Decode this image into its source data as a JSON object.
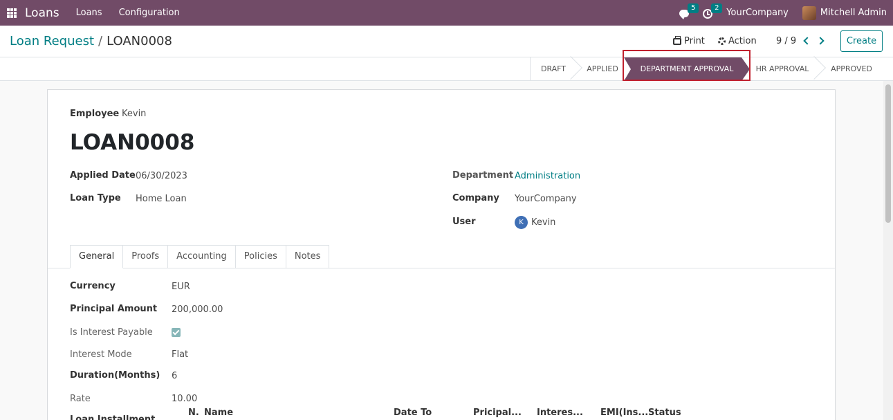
{
  "navbar": {
    "app_name": "Loans",
    "menu": [
      "Loans",
      "Configuration"
    ],
    "messages_count": "5",
    "activities_count": "2",
    "company": "YourCompany",
    "user": "Mitchell Admin"
  },
  "control_panel": {
    "breadcrumb_parent": "Loan Request",
    "breadcrumb_sep": "/",
    "breadcrumb_current": "LOAN0008",
    "print_label": "Print",
    "action_label": "Action",
    "pager": "9 / 9",
    "create_label": "Create"
  },
  "statusbar": {
    "stages": [
      "DRAFT",
      "APPLIED",
      "DEPARTMENT APPROVAL",
      "HR APPROVAL",
      "APPROVED"
    ],
    "active_stage": "DEPARTMENT APPROVAL"
  },
  "form": {
    "employee_label": "Employee",
    "employee": "Kevin",
    "title": "LOAN0008",
    "applied_date_label": "Applied Date",
    "applied_date": "06/30/2023",
    "loan_type_label": "Loan Type",
    "loan_type": "Home Loan",
    "department_label": "Department",
    "department": "Administration",
    "company_label": "Company",
    "company": "YourCompany",
    "user_label": "User",
    "user_initial": "K",
    "user": "Kevin"
  },
  "tabs": [
    "General",
    "Proofs",
    "Accounting",
    "Policies",
    "Notes"
  ],
  "general": {
    "currency_label": "Currency",
    "currency": "EUR",
    "principal_label": "Principal Amount",
    "principal": "200,000.00",
    "interest_payable_label": "Is Interest Payable",
    "interest_payable": true,
    "interest_mode_label": "Interest Mode",
    "interest_mode": "Flat",
    "duration_label": "Duration(Months)",
    "duration": "6",
    "rate_label": "Rate",
    "rate": "10.00",
    "installment_label": "Loan Installment",
    "installment_columns": [
      "N.",
      "Name",
      "Date To",
      "Pricipal...",
      "Interes...",
      "EMI(Ins...",
      "Status"
    ]
  },
  "colors": {
    "brand": "#714b67",
    "accent": "#017e84",
    "highlight": "#c0202e"
  }
}
